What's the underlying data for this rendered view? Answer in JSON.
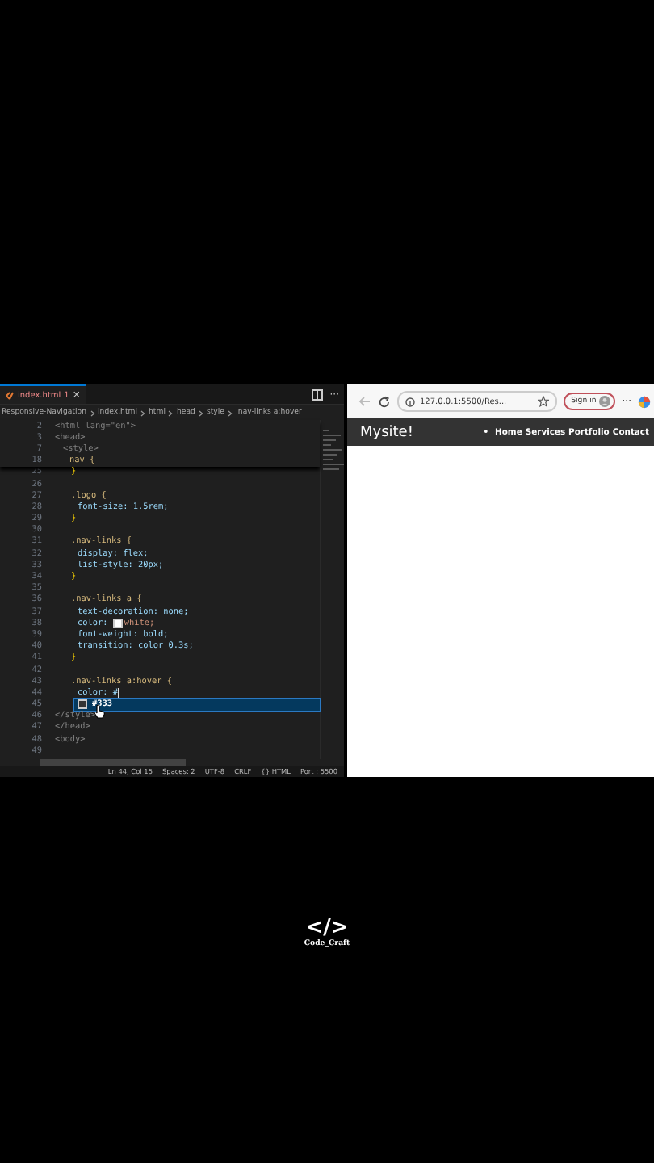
{
  "editor": {
    "tab": {
      "label": "index.html",
      "badge": "1",
      "close": "×"
    },
    "breadcrumbs": [
      "Responsive-Navigation",
      "index.html",
      "html",
      "head",
      "style",
      ".nav-links a:hover"
    ],
    "sticky_lines": [
      {
        "n": "2",
        "kind": "tag",
        "code": "<html lang=\"en\">"
      },
      {
        "n": "3",
        "kind": "tag",
        "code": "<head>"
      },
      {
        "n": "7",
        "kind": "tag",
        "code": "<style>"
      },
      {
        "n": "18",
        "kind": "selector",
        "code": "nav {"
      }
    ],
    "lines": [
      {
        "n": "25",
        "kind": "close",
        "code": "}"
      },
      {
        "n": "26",
        "kind": "blank"
      },
      {
        "n": "27",
        "kind": "selector",
        "code": ".logo {"
      },
      {
        "n": "28",
        "kind": "prop",
        "code": "font-size: 1.5rem;"
      },
      {
        "n": "29",
        "kind": "close",
        "code": "}"
      },
      {
        "n": "30",
        "kind": "blank"
      },
      {
        "n": "31",
        "kind": "selector",
        "code": ".nav-links {"
      },
      {
        "n": "32",
        "kind": "prop",
        "code": "display: flex;"
      },
      {
        "n": "33",
        "kind": "prop",
        "code": "list-style: 20px;"
      },
      {
        "n": "34",
        "kind": "close",
        "code": "}"
      },
      {
        "n": "35",
        "kind": "blank"
      },
      {
        "n": "36",
        "kind": "selector",
        "code": ".nav-links a {"
      },
      {
        "n": "37",
        "kind": "prop",
        "code": "text-decoration: none;"
      },
      {
        "n": "38",
        "kind": "prop",
        "code": "color: ",
        "color": "#ffffff",
        "code_after": "white;"
      },
      {
        "n": "39",
        "kind": "prop",
        "code": "font-weight: bold;"
      },
      {
        "n": "40",
        "kind": "prop",
        "code": "transition: color 0.3s;"
      },
      {
        "n": "41",
        "kind": "close",
        "code": "}"
      },
      {
        "n": "42",
        "kind": "blank"
      },
      {
        "n": "43",
        "kind": "selector",
        "code": ".nav-links a:hover {"
      },
      {
        "n": "44",
        "kind": "prop",
        "code": "color: #",
        "cursor": true
      },
      {
        "n": "45",
        "kind": "suggestion",
        "code": "#333",
        "color": "#333333",
        "selected": true
      },
      {
        "n": "46",
        "kind": "tag",
        "code": "</style>"
      },
      {
        "n": "47",
        "kind": "tag",
        "code": "</head>"
      },
      {
        "n": "48",
        "kind": "tag",
        "code": "<body>"
      },
      {
        "n": "49",
        "kind": "blank"
      }
    ],
    "more": "···",
    "status_bar": [
      "Ln 44, Col 15",
      "Spaces: 2",
      "UTF-8",
      "CRLF",
      "{} HTML",
      "Port : 5500"
    ]
  },
  "browser": {
    "address": "127.0.0.1:5500/Res...",
    "sign_in": "Sign in",
    "more": "···",
    "page": {
      "brand": "Mysite!",
      "bullet": "•",
      "links": [
        "Home",
        "Services",
        "Portfolio",
        "Contact"
      ]
    }
  },
  "watermark_logo": {
    "symbol": "</>",
    "name": "Code_Craft"
  }
}
